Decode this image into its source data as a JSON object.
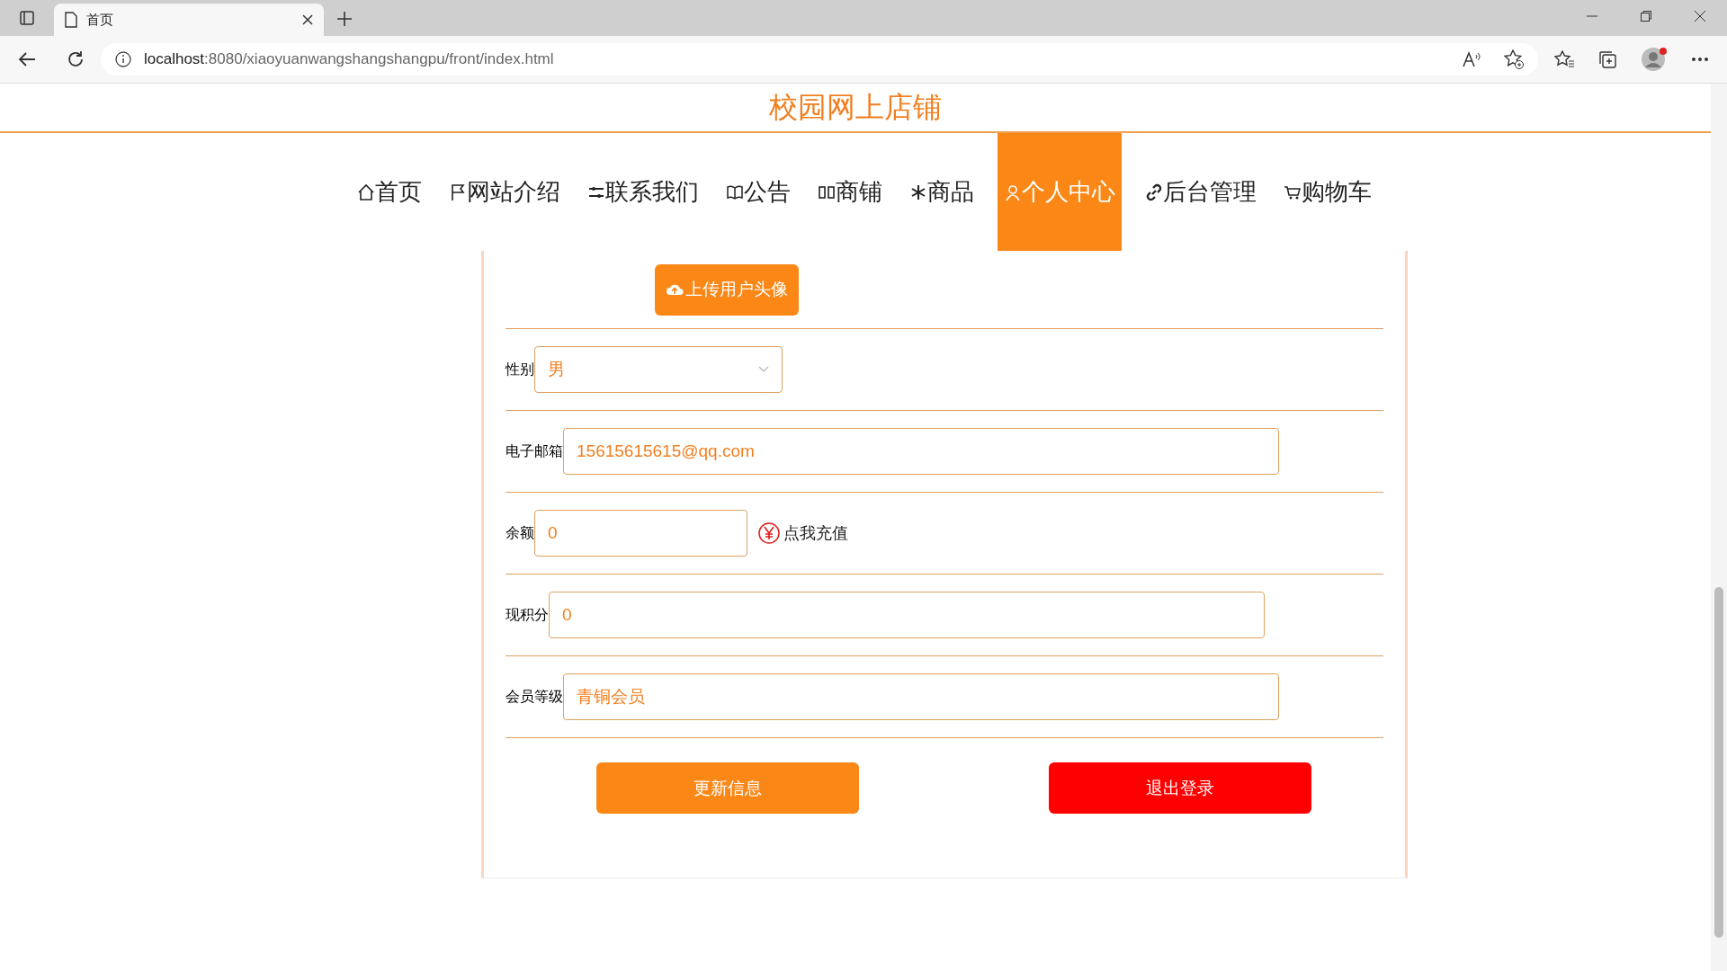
{
  "browser": {
    "tab_title": "首页",
    "url_host": "localhost",
    "url_rest": ":8080/xiaoyuanwangshangshangpu/front/index.html"
  },
  "site_title": "校园网上店铺",
  "nav": [
    {
      "label": "首页",
      "selected": false
    },
    {
      "label": "网站介绍",
      "selected": false
    },
    {
      "label": "联系我们",
      "selected": false
    },
    {
      "label": "公告",
      "selected": false
    },
    {
      "label": "商铺",
      "selected": false
    },
    {
      "label": "商品",
      "selected": false
    },
    {
      "label": "个人中心",
      "selected": true
    },
    {
      "label": "后台管理",
      "selected": false
    },
    {
      "label": "购物车",
      "selected": false
    }
  ],
  "upload_button": "上传用户头像",
  "fields": [
    {
      "kind": "select",
      "label": "性别",
      "value": "男"
    },
    {
      "kind": "input",
      "label": "电子邮箱",
      "value": "15615615615@qq.com"
    },
    {
      "kind": "balance",
      "label": "余额",
      "value": "0",
      "action": "点我充值"
    },
    {
      "kind": "input",
      "label": "现积分",
      "value": "0"
    },
    {
      "kind": "input",
      "label": "会员等级",
      "value": "青铜会员"
    }
  ],
  "buttons": [
    {
      "kind": "primary",
      "label": "更新信息"
    },
    {
      "kind": "danger",
      "label": "退出登录"
    }
  ]
}
